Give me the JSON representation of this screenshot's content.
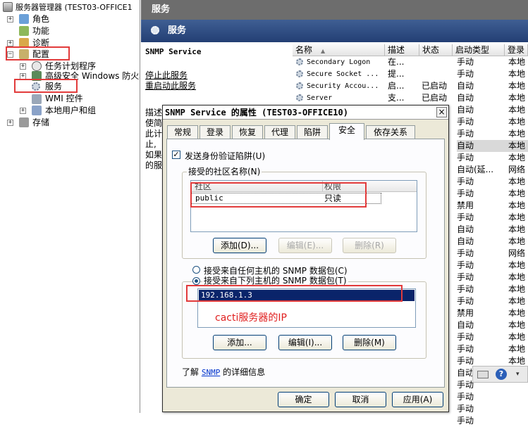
{
  "tree": {
    "root": "服务器管理器 (TEST03-OFFICE1",
    "items": [
      {
        "label": "角色",
        "level": 1,
        "expander": "+"
      },
      {
        "label": "功能",
        "level": 1,
        "expander": ""
      },
      {
        "label": "诊断",
        "level": 1,
        "expander": "+"
      },
      {
        "label": "配置",
        "level": 1,
        "expander": "−"
      },
      {
        "label": "任务计划程序",
        "level": 2,
        "expander": "+"
      },
      {
        "label": "高级安全 Windows 防火墙",
        "level": 2,
        "expander": "+"
      },
      {
        "label": "服务",
        "level": 2,
        "expander": ""
      },
      {
        "label": "WMI 控件",
        "level": 2,
        "expander": ""
      },
      {
        "label": "本地用户和组",
        "level": 2,
        "expander": "+"
      },
      {
        "label": "存储",
        "level": 1,
        "expander": "+"
      }
    ]
  },
  "right": {
    "title": "服务",
    "band_title": "服务",
    "selected_service_name": "SNMP Service",
    "stop_link": "停止此服务",
    "restart_link": "重启动此服务",
    "desc_lines": [
      "描述",
      "使简",
      "此计",
      "止,",
      "如果",
      "的服"
    ],
    "columns": [
      "名称",
      "描述",
      "状态",
      "启动类型",
      "登录"
    ],
    "services": [
      {
        "name": "Secondary Logon",
        "desc": "在...",
        "status": "",
        "startup": "手动",
        "logon": "本地"
      },
      {
        "name": "Secure Socket ...",
        "desc": "提...",
        "status": "",
        "startup": "手动",
        "logon": "本地"
      },
      {
        "name": "Security Accou...",
        "desc": "启...",
        "status": "已启动",
        "startup": "自动",
        "logon": "本地"
      },
      {
        "name": "Server",
        "desc": "支...",
        "status": "已启动",
        "startup": "自动",
        "logon": "本地"
      }
    ],
    "more_rows": [
      {
        "startup": "自动",
        "logon": "本地"
      },
      {
        "startup": "手动",
        "logon": "本地"
      },
      {
        "startup": "手动",
        "logon": "本地"
      },
      {
        "startup": "自动",
        "logon": "本地"
      },
      {
        "startup": "手动",
        "logon": "本地"
      },
      {
        "startup": "自动(延...",
        "logon": "网络"
      },
      {
        "startup": "手动",
        "logon": "本地"
      },
      {
        "startup": "手动",
        "logon": "本地"
      },
      {
        "startup": "禁用",
        "logon": "本地"
      },
      {
        "startup": "手动",
        "logon": "本地"
      },
      {
        "startup": "自动",
        "logon": "本地"
      },
      {
        "startup": "自动",
        "logon": "本地"
      },
      {
        "startup": "手动",
        "logon": "网络"
      },
      {
        "startup": "手动",
        "logon": "本地"
      },
      {
        "startup": "手动",
        "logon": "本地"
      },
      {
        "startup": "手动",
        "logon": "本地"
      },
      {
        "startup": "手动",
        "logon": "本地"
      },
      {
        "startup": "禁用",
        "logon": "本地"
      },
      {
        "startup": "自动",
        "logon": "本地"
      },
      {
        "startup": "手动",
        "logon": "本地"
      },
      {
        "startup": "手动",
        "logon": "本地"
      },
      {
        "startup": "手动",
        "logon": "本地"
      },
      {
        "startup": "自动",
        "logon": "本地"
      },
      {
        "startup": "手动",
        "logon": ""
      },
      {
        "startup": "手动",
        "logon": ""
      },
      {
        "startup": "手动",
        "logon": ""
      },
      {
        "startup": "手动",
        "logon": ""
      }
    ]
  },
  "dialog": {
    "title": "SNMP Service 的属性 (TEST03-OFFICE10)",
    "close_glyph": "×",
    "tabs": [
      "常规",
      "登录",
      "恢复",
      "代理",
      "陷阱",
      "安全",
      "依存关系"
    ],
    "active_tab": "安全",
    "auth_trap_label": "发送身份验证陷阱(U)",
    "auth_trap_checked": true,
    "community_group_label": "接受的社区名称(N)",
    "community_columns": [
      "社区",
      "权限"
    ],
    "community_rows": [
      {
        "community": "public",
        "rights": "只读"
      }
    ],
    "community_buttons": [
      "添加(D)...",
      "编辑(E)...",
      "删除(R)"
    ],
    "radio_any": "接受来自任何主机的 SNMP 数据包(C)",
    "radio_these": "接受来自下列主机的 SNMP 数据包(T)",
    "selected_radio": "these",
    "hosts": [
      "192.168.1.3"
    ],
    "annotation": "cacti服务器的IP",
    "host_buttons": [
      "添加...",
      "编辑(I)...",
      "删除(M)"
    ],
    "learn_more_prefix": "了解",
    "learn_more_link": "SNMP",
    "learn_more_suffix": "的详细信息",
    "footer_buttons": [
      "确定",
      "取消",
      "应用(A)"
    ]
  },
  "colors": {
    "highlight": "#e23b3b",
    "selection": "#0a246a",
    "annotation": "#e02020",
    "band": "#2b4a80"
  }
}
